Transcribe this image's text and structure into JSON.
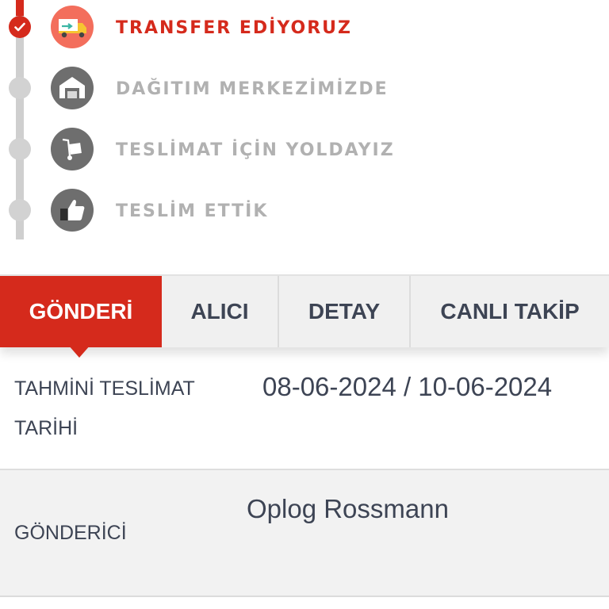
{
  "timeline": {
    "steps": [
      {
        "label": "TRANSFER EDİYORUZ",
        "icon": "delivery-truck-icon",
        "status": "done"
      },
      {
        "label": "DAĞITIM MERKEZİMİZDE",
        "icon": "warehouse-icon",
        "status": "pending"
      },
      {
        "label": "TESLİMAT İÇİN YOLDAYIZ",
        "icon": "hand-truck-icon",
        "status": "pending"
      },
      {
        "label": "TESLİM ETTİK",
        "icon": "thumbs-up-icon",
        "status": "pending"
      }
    ]
  },
  "tabs": [
    {
      "label": "GÖNDERİ",
      "active": true
    },
    {
      "label": "ALICI",
      "active": false
    },
    {
      "label": "DETAY",
      "active": false
    },
    {
      "label": "CANLI TAKİP",
      "active": false
    }
  ],
  "shipment": {
    "estimated_delivery_label": "TAHMİNİ TESLİMAT TARİHİ",
    "estimated_delivery_value": "08-06-2024 / 10-06-2024",
    "sender_label": "GÖNDERİCİ",
    "sender_value": "Oplog Rossmann"
  },
  "colors": {
    "accent": "#d52a1c",
    "accent_light": "#f36e5c",
    "inactive": "#b1b1b1",
    "text": "#3d4454"
  }
}
